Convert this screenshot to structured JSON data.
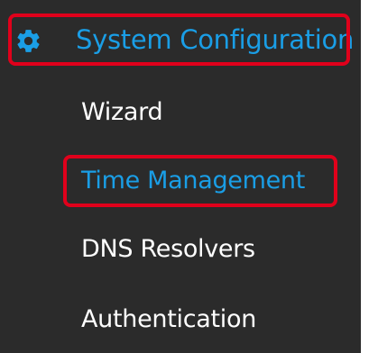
{
  "menu": {
    "header": {
      "label": "System Configuration",
      "icon": "gear-icon"
    },
    "items": [
      {
        "label": "Wizard",
        "active": false
      },
      {
        "label": "Time Management",
        "active": true
      },
      {
        "label": "DNS Resolvers",
        "active": false
      },
      {
        "label": "Authentication",
        "active": false
      }
    ]
  },
  "colors": {
    "panel_background": "#2b2b2b",
    "accent": "#1a9ee6",
    "highlight_border": "#e0001b",
    "text": "#ffffff"
  }
}
